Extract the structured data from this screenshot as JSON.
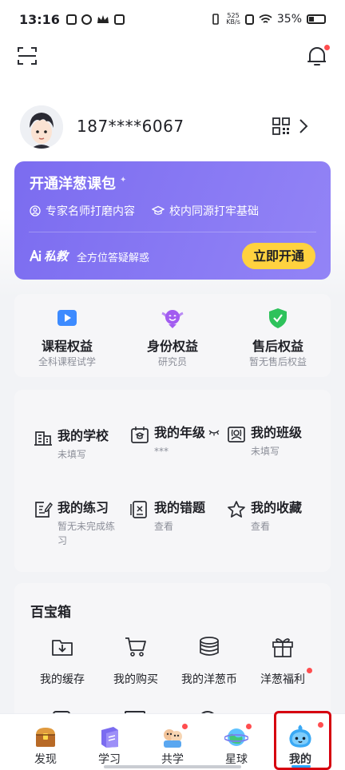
{
  "status_bar": {
    "time": "13:16",
    "net_speed_value": "525",
    "net_speed_unit": "KB/s",
    "battery": "35%"
  },
  "profile": {
    "phone": "187****6067"
  },
  "promo": {
    "title": "开通洋葱课包",
    "feature_1": "专家名师打磨内容",
    "feature_2": "校内同源打牢基础",
    "ai_label": "私教",
    "ai_desc": "全方位答疑解惑",
    "button": "立即开通",
    "colors": {
      "card": "#7b6cf0",
      "button": "#ffd23f"
    }
  },
  "rights": [
    {
      "title": "课程权益",
      "subtitle": "全科课程试学",
      "icon": "play-icon",
      "color": "#3d8bff"
    },
    {
      "title": "身份权益",
      "subtitle": "研究员",
      "icon": "identity-badge-icon",
      "color": "#a25cf0"
    },
    {
      "title": "售后权益",
      "subtitle": "暂无售后权益",
      "icon": "shield-check-icon",
      "color": "#2ec25b"
    }
  ],
  "info": [
    {
      "title": "我的学校",
      "subtitle": "未填写",
      "icon": "school-icon"
    },
    {
      "title": "我的年级",
      "subtitle": "***",
      "icon": "grade-icon"
    },
    {
      "title": "我的班级",
      "subtitle": "未填写",
      "icon": "class-icon"
    },
    {
      "title": "我的练习",
      "subtitle": "暂无未完成练习",
      "icon": "practice-icon"
    },
    {
      "title": "我的错题",
      "subtitle": "查看",
      "icon": "mistakes-icon"
    },
    {
      "title": "我的收藏",
      "subtitle": "查看",
      "icon": "star-icon"
    }
  ],
  "treasure": {
    "title": "百宝箱",
    "tools": [
      {
        "label": "我的缓存",
        "icon": "download-folder-icon"
      },
      {
        "label": "我的购买",
        "icon": "cart-icon"
      },
      {
        "label": "我的洋葱币",
        "icon": "coins-icon"
      },
      {
        "label": "洋葱福利",
        "icon": "gift-icon"
      }
    ]
  },
  "nav": [
    {
      "label": "发现",
      "icon": "treasure-chest-icon"
    },
    {
      "label": "学习",
      "icon": "book-icon"
    },
    {
      "label": "共学",
      "icon": "study-together-icon"
    },
    {
      "label": "星球",
      "icon": "planet-icon"
    },
    {
      "label": "我的",
      "icon": "me-mascot-icon"
    }
  ]
}
